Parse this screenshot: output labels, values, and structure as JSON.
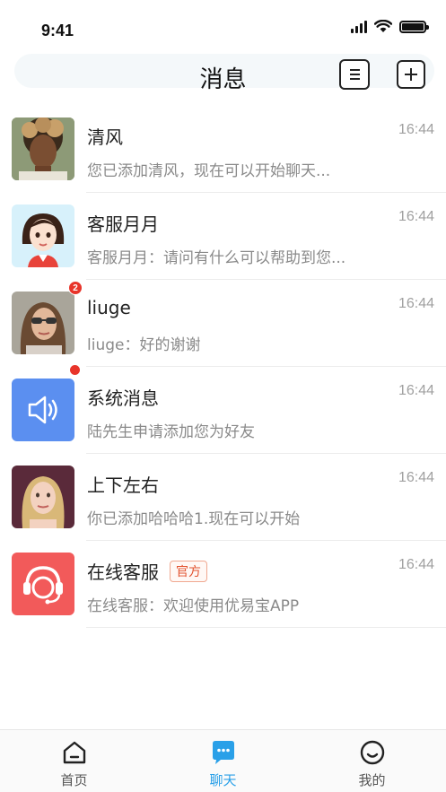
{
  "status_bar": {
    "time": "9:41"
  },
  "nav": {
    "title": "消息",
    "contacts_icon": "contacts-list-icon",
    "add_icon": "add-icon"
  },
  "messages": [
    {
      "name": "清风",
      "preview": "您已添加清风，现在可以开始聊天...",
      "time": "16:44",
      "avatar": "man-curly-hair-photo"
    },
    {
      "name": "客服月月",
      "preview": "客服月月：请问有什么可以帮助到您...",
      "time": "16:44",
      "avatar": "cartoon-girl-avatar"
    },
    {
      "name": "liuge",
      "preview": "liuge：好的谢谢",
      "time": "16:44",
      "avatar": "woman-sunglasses-photo",
      "unread": "2"
    },
    {
      "name": "系统消息",
      "preview": "陆先生申请添加您为好友",
      "time": "16:44",
      "avatar": "speaker-icon",
      "dot": true
    },
    {
      "name": "上下左右",
      "preview": "你已添加哈哈哈1.现在可以开始",
      "time": "16:44",
      "avatar": "blonde-woman-photo"
    },
    {
      "name": "在线客服",
      "tag": "官方",
      "preview": "在线客服：欢迎使用优易宝APP",
      "time": "16:44",
      "avatar": "headset-service-icon"
    }
  ],
  "tabs": [
    {
      "label": "首页",
      "icon": "home-icon",
      "active": false
    },
    {
      "label": "聊天",
      "icon": "chat-bubble-icon",
      "active": true
    },
    {
      "label": "我的",
      "icon": "smile-face-icon",
      "active": false
    }
  ],
  "colors": {
    "accent": "#2aa0e8",
    "badge": "#e8342a",
    "system_icon_bg": "#5b8ff0",
    "service_icon_bg": "#f25a5a"
  }
}
